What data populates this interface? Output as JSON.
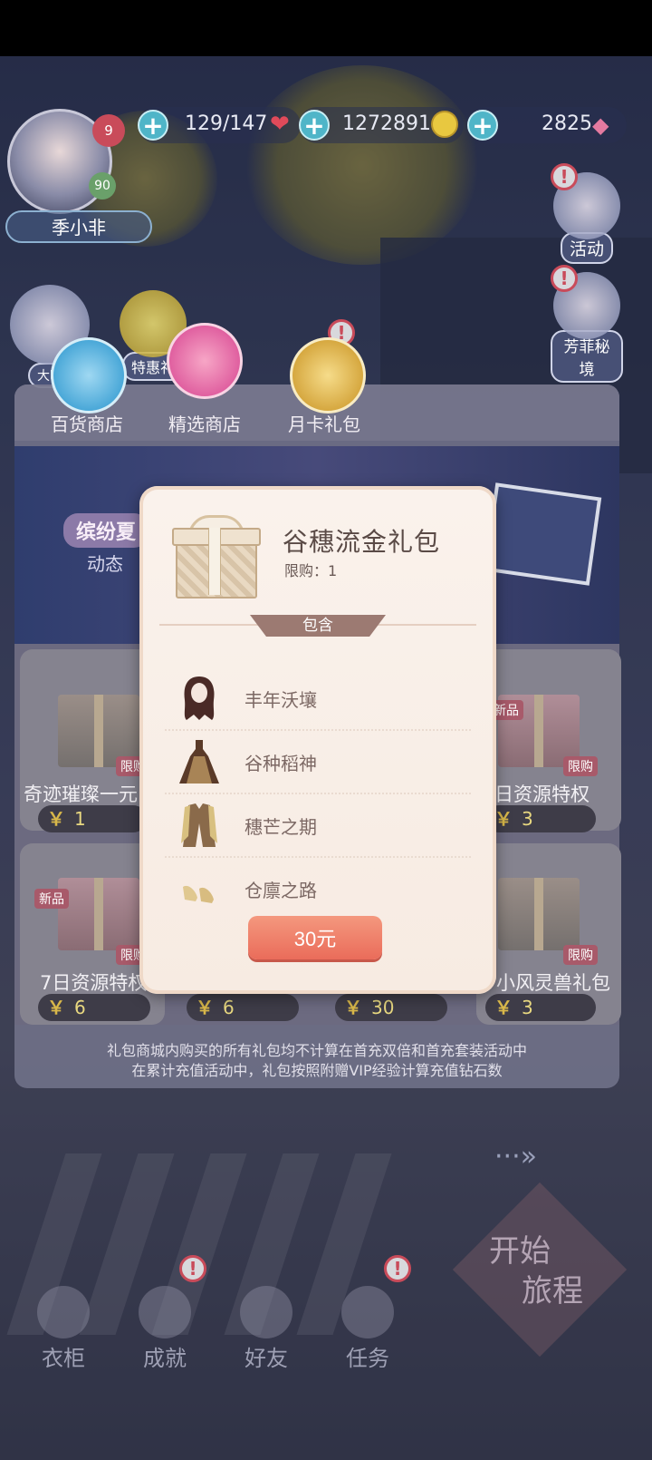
{
  "player": {
    "name": "季小非",
    "level": "9",
    "vip": "90"
  },
  "resources": {
    "stamina": "129/147",
    "gold": "1272891",
    "diamonds": "2825"
  },
  "side_buttons": {
    "activity": "活动",
    "fangfei": "芳菲秘境",
    "mini_left_1": "大喵",
    "mini_left_2": "特惠礼"
  },
  "shop": {
    "tabs": [
      {
        "label": "百货商店"
      },
      {
        "label": "精选商店"
      },
      {
        "label": "月卡礼包"
      }
    ],
    "banner_tag": "缤纷夏",
    "banner_sub": "动态",
    "cards": [
      {
        "name": "奇迹璀璨一元",
        "price": "1"
      },
      {
        "name": "日资源特权",
        "price": "3"
      },
      {
        "name": "7日资源特权",
        "price": "6"
      },
      {
        "name": "",
        "price": "6"
      },
      {
        "name": "",
        "price": "30"
      },
      {
        "name": "小风灵兽礼包",
        "price": "3"
      }
    ],
    "tag_limited": "限购",
    "tag_new": "新品",
    "yuan_symbol": "￥",
    "notice_line1": "礼包商城内购买的所有礼包均不计算在首充双倍和首充套装活动中",
    "notice_line2": "在累计充值活动中，礼包按照附赠VIP经验计算充值钻石数"
  },
  "modal": {
    "title": "谷穗流金礼包",
    "limit": "限购：1",
    "include_label": "包含",
    "items": [
      {
        "name": "丰年沃壤",
        "icon": "hair-icon"
      },
      {
        "name": "谷种稻神",
        "icon": "dress-icon"
      },
      {
        "name": "穗芒之期",
        "icon": "coat-icon"
      },
      {
        "name": "仓廪之路",
        "icon": "shoes-icon"
      }
    ],
    "price_button": "30元"
  },
  "bottom_nav": [
    {
      "label": "衣柜"
    },
    {
      "label": "成就"
    },
    {
      "label": "好友"
    },
    {
      "label": "任务"
    }
  ],
  "start": {
    "line1": "开始",
    "line2": "旅程",
    "next_arrow": "···»"
  }
}
